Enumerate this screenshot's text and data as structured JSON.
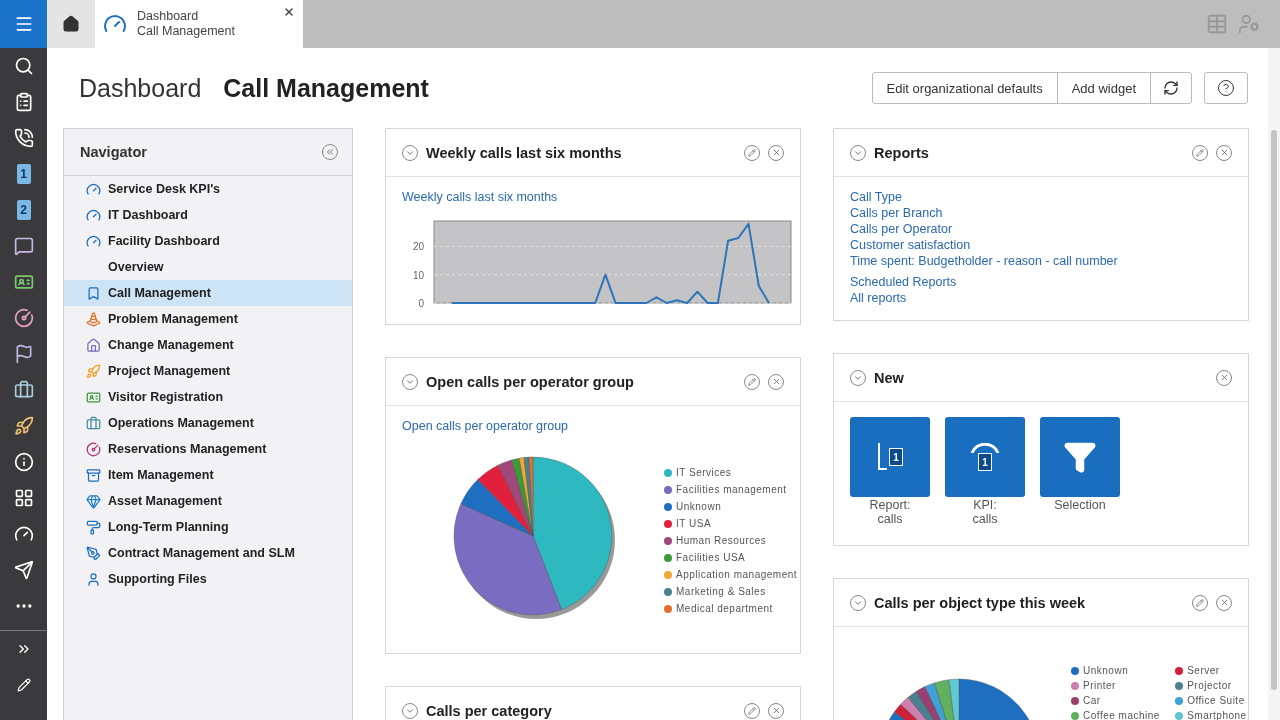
{
  "rail": {
    "calendars": [
      "1",
      "2"
    ]
  },
  "top_bar": {
    "tabs": [
      {
        "kind": "home",
        "selected": false
      },
      {
        "kind": "page",
        "title": "Dashboard",
        "subtitle": "Call Management",
        "selected": true
      }
    ]
  },
  "header": {
    "title": "Dashboard",
    "subtitle": "Call Management",
    "buttons": [
      "Edit organizational defaults",
      "Add widget"
    ]
  },
  "navigator": {
    "title": "Navigator",
    "items": [
      {
        "label": "Service Desk KPI's",
        "selected": false
      },
      {
        "label": "IT Dashboard",
        "selected": false
      },
      {
        "label": "Facility Dashboard",
        "selected": false
      },
      {
        "label": "Overview",
        "selected": false
      },
      {
        "label": "Call Management",
        "selected": true
      },
      {
        "label": "Problem Management",
        "selected": false
      },
      {
        "label": "Change Management",
        "selected": false
      },
      {
        "label": "Project Management",
        "selected": false
      },
      {
        "label": "Visitor Registration",
        "selected": false
      },
      {
        "label": "Operations Management",
        "selected": false
      },
      {
        "label": "Reservations Management",
        "selected": false
      },
      {
        "label": "Item Management",
        "selected": false
      },
      {
        "label": "Asset Management",
        "selected": false
      },
      {
        "label": "Long-Term Planning",
        "selected": false
      },
      {
        "label": "Contract Management and SLM",
        "selected": false
      },
      {
        "label": "Supporting Files",
        "selected": false
      }
    ]
  },
  "columns": [
    [
      {
        "kind": "line",
        "title": "Weekly calls last six months",
        "editable": true,
        "link": "Weekly calls last six months",
        "chart_data": {
          "type": "line",
          "ylim": [
            0,
            29
          ],
          "yticks": [
            0,
            10,
            20
          ],
          "values": [
            0,
            0,
            0,
            0,
            0,
            0,
            0,
            0,
            0,
            0,
            0,
            0,
            0,
            0,
            0,
            10,
            0,
            0,
            0,
            0,
            2,
            0,
            1,
            0,
            4,
            0,
            0,
            22,
            23,
            28,
            6,
            0
          ]
        }
      },
      {
        "kind": "pie",
        "title": "Open calls per operator group",
        "editable": true,
        "link": "Open calls per operator group",
        "legend": [
          {
            "label": "IT Services",
            "color": "#2eb8c0"
          },
          {
            "label": "Facilities management",
            "color": "#7a6cc0"
          },
          {
            "label": "Unknown",
            "color": "#1f6fc0"
          },
          {
            "label": "IT USA",
            "color": "#e0203c"
          },
          {
            "label": "Human Resources",
            "color": "#a0487a"
          },
          {
            "label": "Facilities USA",
            "color": "#3a9a3a"
          },
          {
            "label": "Application management",
            "color": "#f0a830"
          },
          {
            "label": "Marketing & Sales",
            "color": "#4a8090"
          },
          {
            "label": "Medical department",
            "color": "#e07030"
          }
        ]
      },
      {
        "kind": "pending",
        "title": "Calls per category",
        "editable": true
      }
    ],
    [
      {
        "kind": "links",
        "title": "Reports",
        "editable": true,
        "groups": [
          [
            "Call Type",
            "Calls per Branch",
            "Calls per Operator",
            "Customer satisfaction",
            "Time spent: Budgetholder - reason - call number"
          ],
          [
            "Scheduled Reports",
            "All reports"
          ]
        ]
      },
      {
        "kind": "tiles",
        "title": "New",
        "editable": false,
        "tiles": [
          {
            "label": "Report: calls",
            "badge": "1"
          },
          {
            "label": "KPI: calls",
            "badge": "1"
          },
          {
            "label": "Selection"
          }
        ]
      },
      {
        "kind": "pie-wide",
        "title": "Calls per object type this week",
        "editable": true,
        "legend": [
          {
            "label": "Unknown",
            "color": "#1f6fc0"
          },
          {
            "label": "Server",
            "color": "#d02038"
          },
          {
            "label": "Printer",
            "color": "#d080b0"
          },
          {
            "label": "Projector",
            "color": "#4a8090"
          },
          {
            "label": "Car",
            "color": "#9a4070"
          },
          {
            "label": "Office Suite",
            "color": "#40a0d8"
          },
          {
            "label": "Coffee machine",
            "color": "#60b060"
          },
          {
            "label": "Smartphone",
            "color": "#60c8d0"
          }
        ]
      }
    ]
  ]
}
